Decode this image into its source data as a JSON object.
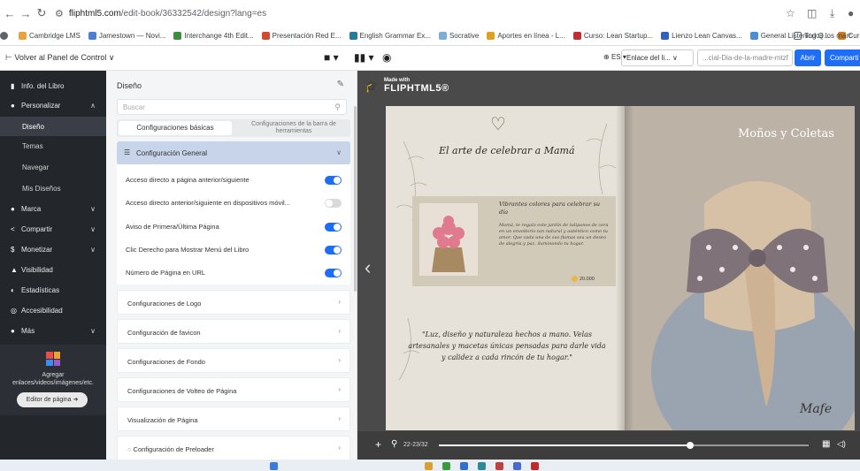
{
  "browser": {
    "url_domain": "fliphtml5.com",
    "url_path": "/edit-book/36332542/design?lang=es",
    "bookmarks": [
      {
        "label": "Cambridge LMS",
        "color": "#e8a33a"
      },
      {
        "label": "Jamestown — Novi...",
        "color": "#4a7fd4"
      },
      {
        "label": "Interchange 4th Edit...",
        "color": "#3e8e3e"
      },
      {
        "label": "Presentación Red E...",
        "color": "#d44a2e"
      },
      {
        "label": "English Grammar Ex...",
        "color": "#2a7a9a"
      },
      {
        "label": "Socrative",
        "color": "#7ab0d8"
      },
      {
        "label": "Aportes en línea - L...",
        "color": "#e0a020"
      },
      {
        "label": "Curso: Lean Startup...",
        "color": "#c03030"
      },
      {
        "label": "Lienzo Lean Canvas...",
        "color": "#3060c0"
      },
      {
        "label": "General Listening Q...",
        "color": "#4a90d0"
      },
      {
        "label": "Curso: Elaboración...",
        "color": "#d08020"
      }
    ],
    "all_bookmarks": "Todos los marc"
  },
  "toolbar": {
    "back_label": "Volver al Panel de Control",
    "lang": "ES",
    "share_select": "Enlace del li...",
    "link_value": "...cial-Dia-de-la-madre-mtzf",
    "open_label": "Abrir",
    "share_label": "Comparti"
  },
  "sidebar": {
    "items": [
      {
        "label": "Info. del Libro",
        "icon": "book-icon"
      },
      {
        "label": "Personalizar",
        "icon": "palette-icon"
      },
      {
        "label": "Marca",
        "icon": "brand-icon"
      },
      {
        "label": "Compartir",
        "icon": "share-icon"
      },
      {
        "label": "Monetizar",
        "icon": "money-icon"
      },
      {
        "label": "Visibilidad",
        "icon": "lock-icon"
      },
      {
        "label": "Estadísticas",
        "icon": "chart-icon"
      },
      {
        "label": "Accesibilidad",
        "icon": "accessibility-icon"
      },
      {
        "label": "Más",
        "icon": "more-icon"
      }
    ],
    "subitems": [
      "Diseño",
      "Temas",
      "Navegar",
      "Mis Diseños"
    ],
    "add_text_1": "Agregar",
    "add_text_2": "enlaces/videos/imágenes/etc.",
    "editor_button": "Editor de página ➜"
  },
  "panel": {
    "title": "Diseño",
    "search_placeholder": "Buscar",
    "tab_basic": "Configuraciones básicas",
    "tab_toolbar": "Configuraciones de la barra de herramientas",
    "general_header": "Configuración General",
    "toggles": [
      {
        "label": "Acceso directo a página anterior/siguiente",
        "on": true
      },
      {
        "label": "Acceso directo anterior/siguiente en dispositivos móvil...",
        "on": false
      },
      {
        "label": "Aviso de Primera/Última Página",
        "on": true
      },
      {
        "label": "Clic Derecho para Mostrar Menú del Libro",
        "on": true
      },
      {
        "label": "Número de Página en URL",
        "on": true
      }
    ],
    "sections": [
      "Configuraciones de Logo",
      "Configuración de favicon",
      "Configuraciones de Fondo",
      "Configuraciones de Volteo de Página",
      "Visualización de Página",
      "Configuración de Preloader"
    ]
  },
  "preview": {
    "made_with": "Made with",
    "brand": "FLIPHTML5®",
    "page_title": "El arte de celebrar a Mamá",
    "product_head": "Vibrantes colores para celebrar su día",
    "product_desc": "Mamá, te regalo este jardín de tulipanes de cera en un envoltorio tan natural y auténtico como tu amor. Que cada una de sus flamas sea un deseo de alegría y paz, iluminando tu hogar.",
    "price": "20.000",
    "quote": "\"Luz, diseño y naturaleza hechos a mano. Velas artesanales y macetas únicas pensadas para darle vida y calidez a cada rincón de tu hogar.\"",
    "right_title": "Moños y Coletas",
    "signature": "Mafe",
    "page_indicator": "22-23/32",
    "progress_fraction": 0.68
  }
}
